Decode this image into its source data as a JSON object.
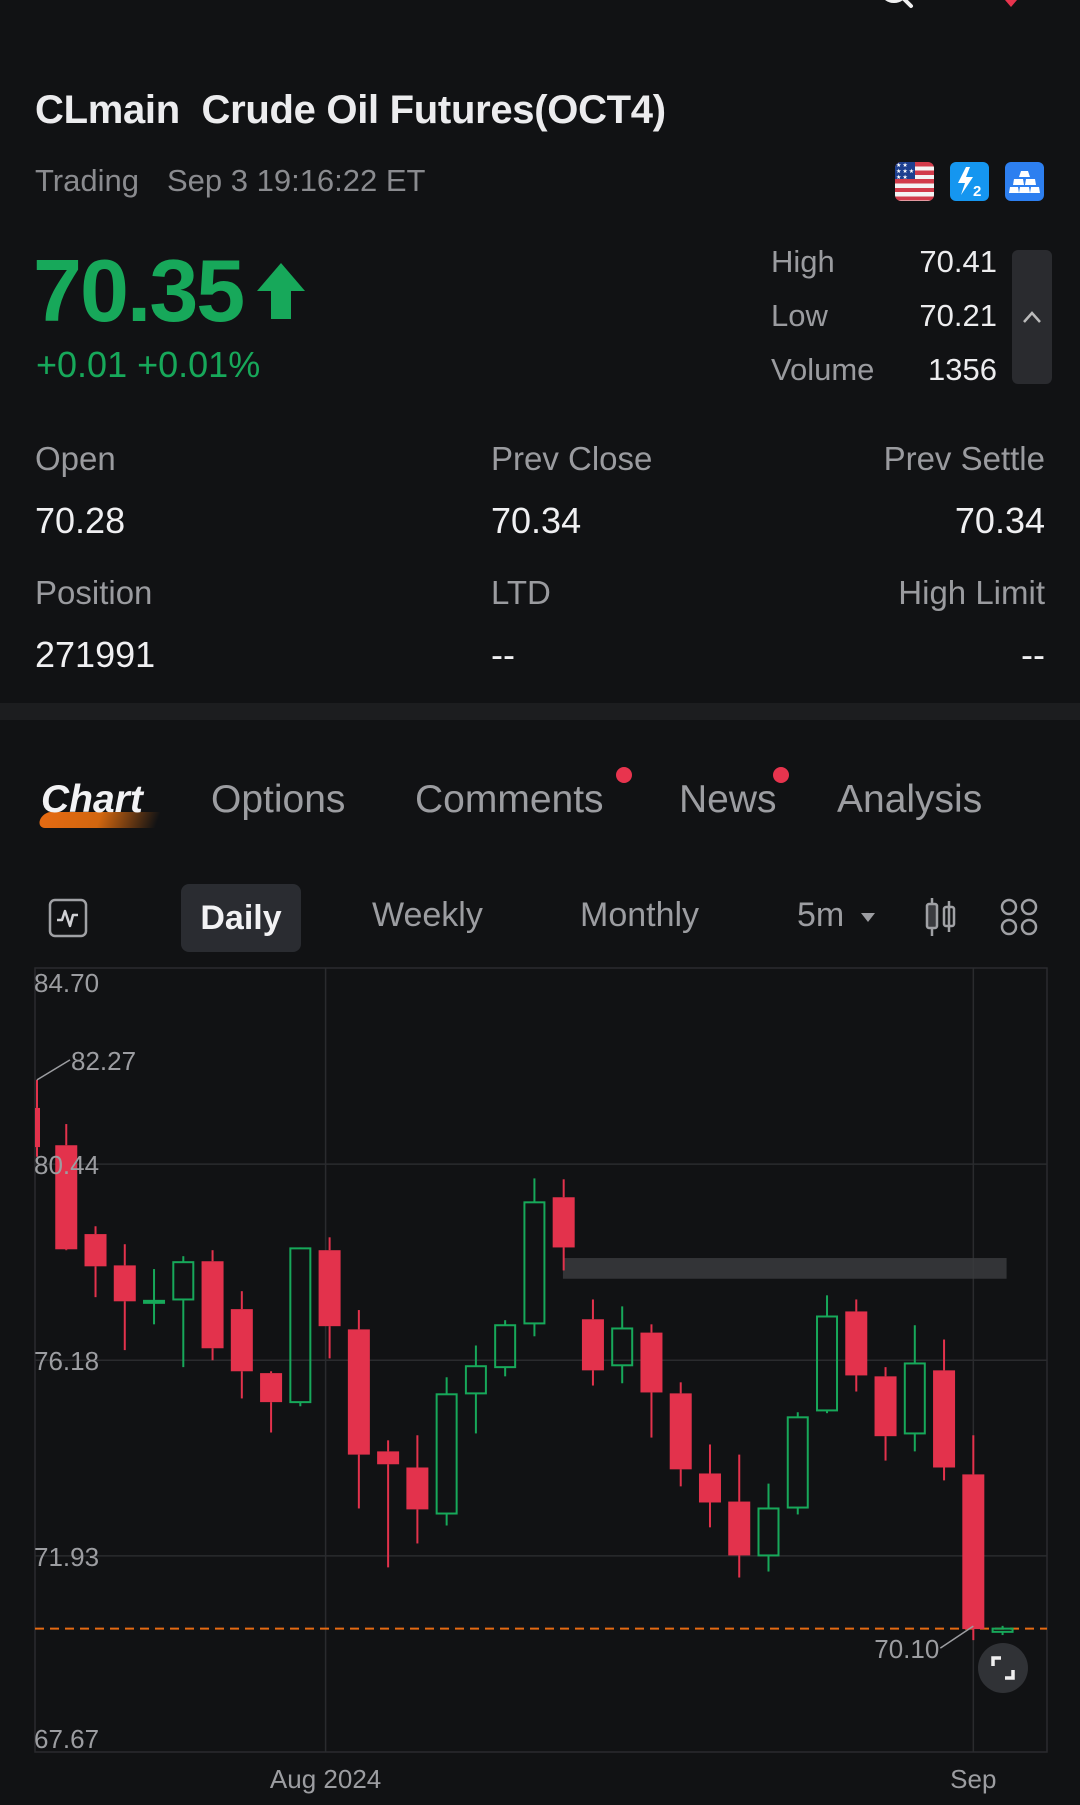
{
  "header": {
    "symbol": "CLmain",
    "name": "Crude Oil Futures(OCT4)",
    "status": "Trading",
    "timestamp": "Sep 3 19:16:22 ET",
    "badges": [
      "us-flag-icon",
      "level2-icon",
      "gold-bars-icon"
    ]
  },
  "quote": {
    "price": "70.35",
    "direction": "up",
    "change": "+0.01",
    "change_pct": "+0.01%",
    "high_label": "High",
    "high": "70.41",
    "low_label": "Low",
    "low": "70.21",
    "volume_label": "Volume",
    "volume": "1356"
  },
  "stats": [
    {
      "label": "Open",
      "value": "70.28"
    },
    {
      "label": "Prev Close",
      "value": "70.34"
    },
    {
      "label": "Prev Settle",
      "value": "70.34"
    },
    {
      "label": "Position",
      "value": "271991"
    },
    {
      "label": "LTD",
      "value": "--"
    },
    {
      "label": "High Limit",
      "value": "--"
    }
  ],
  "tabs": [
    {
      "label": "Chart",
      "active": true,
      "dot": false
    },
    {
      "label": "Options",
      "active": false,
      "dot": false
    },
    {
      "label": "Comments",
      "active": false,
      "dot": true
    },
    {
      "label": "News",
      "active": false,
      "dot": true
    },
    {
      "label": "Analysis",
      "active": false,
      "dot": false
    }
  ],
  "toolbar": {
    "periods": [
      "Daily",
      "Weekly",
      "Monthly"
    ],
    "selected_period": "Daily",
    "interval": "5m"
  },
  "colors": {
    "up": "#17a85a",
    "down": "#e3324c",
    "accent": "#e56a12",
    "background": "#111214"
  },
  "chart_data": {
    "type": "candlestick",
    "y_ticks": [
      "84.70",
      "80.44",
      "76.18",
      "71.93",
      "67.67"
    ],
    "ylim": [
      67.67,
      84.7
    ],
    "x_labels": [
      {
        "label": "Aug 2024",
        "index": 10
      },
      {
        "label": "Sep",
        "index": 32
      }
    ],
    "annotations": {
      "max_label": "82.27",
      "max_index": 0,
      "min_label": "70.10",
      "min_index": 32
    },
    "current_price_line": 70.35,
    "candles": [
      {
        "o": 81.66,
        "h": 82.27,
        "l": 80.6,
        "c": 80.81
      },
      {
        "o": 80.85,
        "h": 81.31,
        "l": 78.57,
        "c": 78.59
      },
      {
        "o": 78.92,
        "h": 79.09,
        "l": 77.55,
        "c": 78.22
      },
      {
        "o": 78.24,
        "h": 78.7,
        "l": 76.4,
        "c": 77.46
      },
      {
        "o": 77.46,
        "h": 78.16,
        "l": 76.96,
        "c": 77.47
      },
      {
        "o": 77.5,
        "h": 78.44,
        "l": 76.03,
        "c": 78.31
      },
      {
        "o": 78.33,
        "h": 78.57,
        "l": 76.18,
        "c": 76.44
      },
      {
        "o": 77.29,
        "h": 77.68,
        "l": 75.35,
        "c": 75.94
      },
      {
        "o": 75.9,
        "h": 75.94,
        "l": 74.61,
        "c": 75.27
      },
      {
        "o": 75.27,
        "h": 78.63,
        "l": 75.18,
        "c": 78.61
      },
      {
        "o": 78.57,
        "h": 78.85,
        "l": 76.22,
        "c": 76.92
      },
      {
        "o": 76.85,
        "h": 77.27,
        "l": 72.96,
        "c": 74.13
      },
      {
        "o": 74.2,
        "h": 74.44,
        "l": 71.68,
        "c": 73.92
      },
      {
        "o": 73.85,
        "h": 74.55,
        "l": 72.2,
        "c": 72.94
      },
      {
        "o": 72.85,
        "h": 75.81,
        "l": 72.59,
        "c": 75.44
      },
      {
        "o": 75.46,
        "h": 76.5,
        "l": 74.59,
        "c": 76.05
      },
      {
        "o": 76.03,
        "h": 77.05,
        "l": 75.83,
        "c": 76.94
      },
      {
        "o": 76.98,
        "h": 80.13,
        "l": 76.7,
        "c": 79.61
      },
      {
        "o": 79.72,
        "h": 80.11,
        "l": 78.13,
        "c": 78.63
      },
      {
        "o": 77.07,
        "h": 77.5,
        "l": 75.63,
        "c": 75.96
      },
      {
        "o": 76.07,
        "h": 77.35,
        "l": 75.68,
        "c": 76.87
      },
      {
        "o": 76.78,
        "h": 76.96,
        "l": 74.5,
        "c": 75.48
      },
      {
        "o": 75.46,
        "h": 75.7,
        "l": 73.44,
        "c": 73.81
      },
      {
        "o": 73.72,
        "h": 74.35,
        "l": 72.55,
        "c": 73.09
      },
      {
        "o": 73.11,
        "h": 74.13,
        "l": 71.46,
        "c": 71.94
      },
      {
        "o": 71.94,
        "h": 73.5,
        "l": 71.59,
        "c": 72.96
      },
      {
        "o": 72.98,
        "h": 75.05,
        "l": 72.83,
        "c": 74.94
      },
      {
        "o": 75.09,
        "h": 77.59,
        "l": 75.03,
        "c": 77.13
      },
      {
        "o": 77.24,
        "h": 77.5,
        "l": 75.5,
        "c": 75.85
      },
      {
        "o": 75.83,
        "h": 76.03,
        "l": 74.0,
        "c": 74.53
      },
      {
        "o": 74.59,
        "h": 76.94,
        "l": 74.2,
        "c": 76.11
      },
      {
        "o": 75.96,
        "h": 76.63,
        "l": 73.57,
        "c": 73.85
      },
      {
        "o": 73.7,
        "h": 74.55,
        "l": 70.1,
        "c": 70.34
      },
      {
        "o": 70.28,
        "h": 70.41,
        "l": 70.21,
        "c": 70.35
      }
    ],
    "highlight_band": {
      "from_index": 19,
      "to_index": 33,
      "low": 77.95,
      "high": 78.4
    }
  }
}
